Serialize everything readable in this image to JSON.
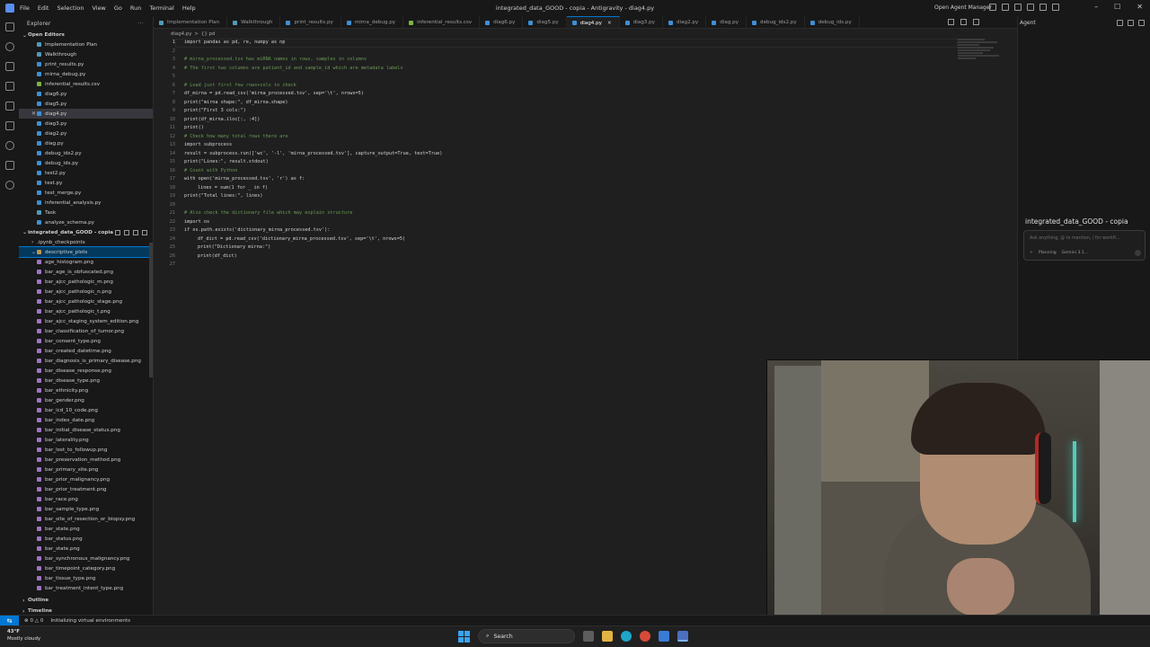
{
  "window": {
    "title": "integrated_data_GOOD - copia - Antigravity - diag4.py",
    "menu": [
      "File",
      "Edit",
      "Selection",
      "View",
      "Go",
      "Run",
      "Terminal",
      "Help"
    ],
    "agent_manager": "Open Agent Manager"
  },
  "sidebar": {
    "header": "Explorer",
    "open_editors_label": "Open Editors",
    "open_editors": [
      {
        "name": "Implementation Plan",
        "type": "md"
      },
      {
        "name": "Walkthrough",
        "type": "md"
      },
      {
        "name": "print_results.py",
        "type": "py"
      },
      {
        "name": "mirna_debug.py",
        "type": "py"
      },
      {
        "name": "inferential_results.csv",
        "type": "csv"
      },
      {
        "name": "diag6.py",
        "type": "py"
      },
      {
        "name": "diag5.py",
        "type": "py"
      },
      {
        "name": "diag4.py",
        "type": "py",
        "active": true
      },
      {
        "name": "diag3.py",
        "type": "py"
      },
      {
        "name": "diag2.py",
        "type": "py"
      },
      {
        "name": "diag.py",
        "type": "py"
      },
      {
        "name": "debug_ids2.py",
        "type": "py"
      },
      {
        "name": "debug_ids.py",
        "type": "py"
      },
      {
        "name": "test2.py",
        "type": "py"
      },
      {
        "name": "test.py",
        "type": "py"
      },
      {
        "name": "test_merge.py",
        "type": "py"
      },
      {
        "name": "inferential_analysis.py",
        "type": "py"
      },
      {
        "name": "Task",
        "type": "md"
      },
      {
        "name": "analyze_schema.py",
        "type": "py"
      }
    ],
    "workspace_label": "integrated_data_GOOD - copia",
    "checkpoints_folder": ".ipynb_checkpoints",
    "selected_folder": "descriptive_plots",
    "plot_files": [
      "age_histogram.png",
      "bar_age_is_obfuscated.png",
      "bar_ajcc_pathologic_m.png",
      "bar_ajcc_pathologic_n.png",
      "bar_ajcc_pathologic_stage.png",
      "bar_ajcc_pathologic_t.png",
      "bar_ajcc_staging_system_edition.png",
      "bar_classification_of_tumor.png",
      "bar_consent_type.png",
      "bar_created_datetime.png",
      "bar_diagnosis_is_primary_disease.png",
      "bar_disease_response.png",
      "bar_disease_type.png",
      "bar_ethnicity.png",
      "bar_gender.png",
      "bar_icd_10_code.png",
      "bar_index_date.png",
      "bar_initial_disease_status.png",
      "bar_laterality.png",
      "bar_lost_to_followup.png",
      "bar_preservation_method.png",
      "bar_primary_site.png",
      "bar_prior_malignancy.png",
      "bar_prior_treatment.png",
      "bar_race.png",
      "bar_sample_type.png",
      "bar_site_of_resection_or_biopsy.png",
      "bar_state.png",
      "bar_status.png",
      "bar_state.png",
      "bar_synchronous_malignancy.png",
      "bar_timepoint_category.png",
      "bar_tissue_type.png",
      "bar_treatment_intent_type.png"
    ],
    "outline_label": "Outline",
    "timeline_label": "Timeline"
  },
  "tabs": [
    {
      "label": "Implementation Plan",
      "type": "md"
    },
    {
      "label": "Walkthrough",
      "type": "md"
    },
    {
      "label": "print_results.py",
      "type": "py"
    },
    {
      "label": "mirna_debug.py",
      "type": "py"
    },
    {
      "label": "inferential_results.csv",
      "type": "csv"
    },
    {
      "label": "diag6.py",
      "type": "py"
    },
    {
      "label": "diag5.py",
      "type": "py"
    },
    {
      "label": "diag4.py",
      "type": "py",
      "active": true
    },
    {
      "label": "diag3.py",
      "type": "py"
    },
    {
      "label": "diag2.py",
      "type": "py"
    },
    {
      "label": "diag.py",
      "type": "py"
    },
    {
      "label": "debug_ids2.py",
      "type": "py"
    },
    {
      "label": "debug_ids.py",
      "type": "py"
    }
  ],
  "breadcrumb": [
    "diag4.py",
    ">",
    "{} pd"
  ],
  "editor": {
    "lines": [
      {
        "n": "1",
        "text": "import pandas as pd, re, numpy as np",
        "kind": "code"
      },
      {
        "n": "2",
        "text": "",
        "kind": "code"
      },
      {
        "n": "3",
        "text": "# mirna_processed.tsv has miRNA names in rows, samples in columns",
        "kind": "cmt"
      },
      {
        "n": "4",
        "text": "# The first two columns are patient_id and sample_id which are metadata labels",
        "kind": "cmt"
      },
      {
        "n": "5",
        "text": "",
        "kind": "code"
      },
      {
        "n": "6",
        "text": "# Load just first few rows+cols to check",
        "kind": "cmt"
      },
      {
        "n": "7",
        "text": "df_mirna = pd.read_csv('mirna_processed.tsv', sep='\\t', nrows=5)",
        "kind": "code"
      },
      {
        "n": "8",
        "text": "print(\"mirna shape:\", df_mirna.shape)",
        "kind": "code"
      },
      {
        "n": "9",
        "text": "print(\"First 3 cols:\")",
        "kind": "code"
      },
      {
        "n": "10",
        "text": "print(df_mirna.iloc[:, :4])",
        "kind": "code"
      },
      {
        "n": "11",
        "text": "print()",
        "kind": "code"
      },
      {
        "n": "12",
        "text": "# Check how many total rows there are",
        "kind": "cmt"
      },
      {
        "n": "13",
        "text": "import subprocess",
        "kind": "code"
      },
      {
        "n": "14",
        "text": "result = subprocess.run(['wc', '-l', 'mirna_processed.tsv'], capture_output=True, text=True)",
        "kind": "code"
      },
      {
        "n": "15",
        "text": "print(\"Lines:\", result.stdout)",
        "kind": "code"
      },
      {
        "n": "16",
        "text": "# Count with Python",
        "kind": "cmt"
      },
      {
        "n": "17",
        "text": "with open('mirna_processed.tsv', 'r') as f:",
        "kind": "code"
      },
      {
        "n": "18",
        "text": "lines = sum(1 for _ in f)",
        "kind": "ind"
      },
      {
        "n": "19",
        "text": "print(\"Total lines:\", lines)",
        "kind": "code"
      },
      {
        "n": "20",
        "text": "",
        "kind": "code"
      },
      {
        "n": "21",
        "text": "# Also check the dictionary file which may explain structure",
        "kind": "cmt"
      },
      {
        "n": "22",
        "text": "import os",
        "kind": "code"
      },
      {
        "n": "23",
        "text": "if os.path.exists('dictionary_mirna_processed.tsv'):",
        "kind": "code"
      },
      {
        "n": "24",
        "text": "df_dict = pd.read_csv('dictionary_mirna_processed.tsv', sep='\\t', nrows=5)",
        "kind": "ind"
      },
      {
        "n": "25",
        "text": "print(\"Dictionary mirna:\")",
        "kind": "ind"
      },
      {
        "n": "26",
        "text": "print(df_dict)",
        "kind": "ind"
      },
      {
        "n": "27",
        "text": "",
        "kind": "code"
      }
    ]
  },
  "agent": {
    "label": "Agent",
    "workspace_title": "integrated_data_GOOD - copia",
    "input_placeholder": "Ask anything, @ to mention, / for workfl...",
    "mode": "Planning",
    "model": "Gemini 3.1..."
  },
  "statusbar": {
    "problems": "⊗ 0 △ 0",
    "message": "Initializing virtual environments"
  },
  "taskbar": {
    "weather_temp": "43°F",
    "weather_desc": "Mostly cloudy",
    "search_label": "Search"
  },
  "colors": {
    "accent": "#0078d4",
    "comment": "#6a9955",
    "selection": "#04395e"
  }
}
